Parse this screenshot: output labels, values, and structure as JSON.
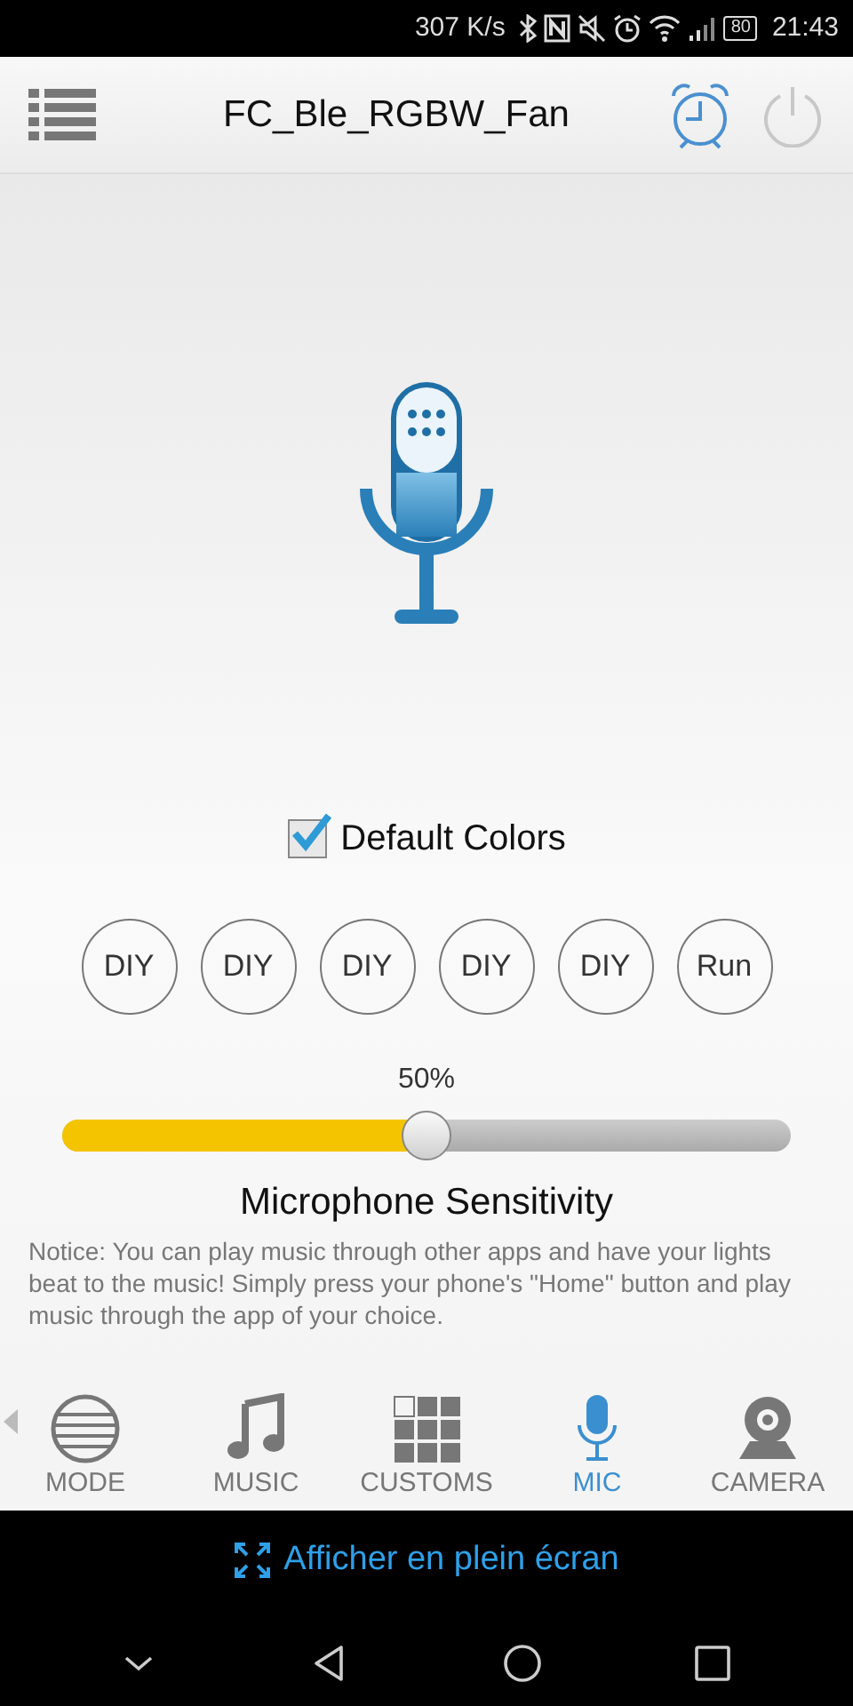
{
  "status_bar": {
    "speed": "307 K/s",
    "battery": "80",
    "time": "21:43"
  },
  "header": {
    "title": "FC_Ble_RGBW_Fan"
  },
  "default_colors": {
    "label": "Default Colors",
    "checked": true
  },
  "buttons": [
    {
      "label": "DIY"
    },
    {
      "label": "DIY"
    },
    {
      "label": "DIY"
    },
    {
      "label": "DIY"
    },
    {
      "label": "DIY"
    },
    {
      "label": "Run"
    }
  ],
  "sensitivity": {
    "reading": "50%",
    "level": 0.5,
    "title": "Microphone Sensitivity"
  },
  "notice": "Notice: You can play music through other apps and have your lights beat to the music! Simply press your phone's \"Home\" button and play music through the app of your choice.",
  "tabs": [
    {
      "kind": "mode",
      "label": "MODE",
      "selected": false
    },
    {
      "kind": "music",
      "label": "MUSIC",
      "selected": false
    },
    {
      "kind": "customs",
      "label": "CUSTOMS",
      "selected": false
    },
    {
      "kind": "mic",
      "label": "MIC",
      "selected": true
    },
    {
      "kind": "camera",
      "label": "CAMERA",
      "selected": false
    }
  ],
  "fullscreen": {
    "label": "Afficher en plein écran"
  }
}
